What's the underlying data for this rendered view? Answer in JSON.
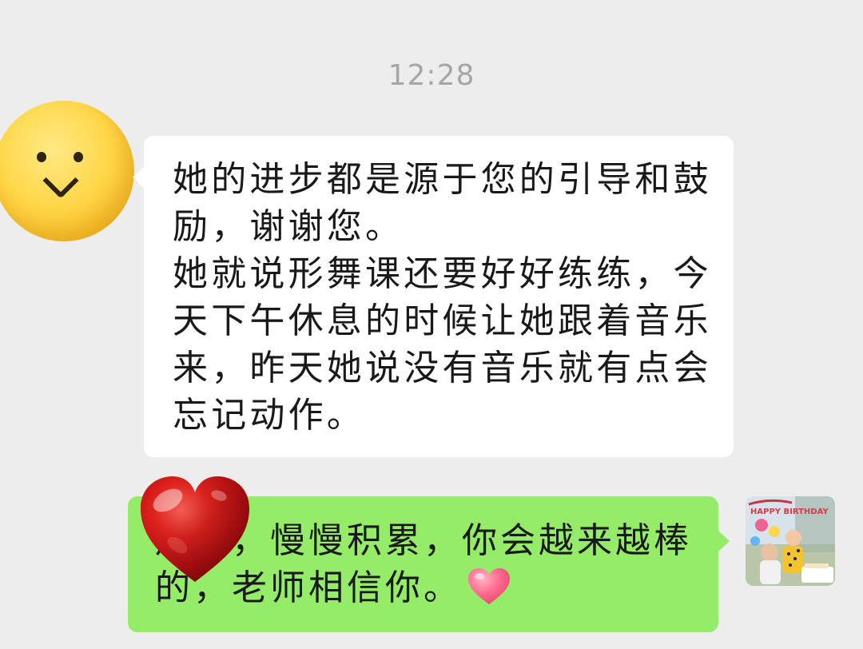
{
  "chat": {
    "timestamp": "12:28",
    "incoming": {
      "avatar_icon": "smiley-face-avatar",
      "text": "她的进步都是源于您的引导和鼓励，谢谢您。\n她就说形舞课还要好好练练，今天下午休息的时候让她跟着音乐来，昨天她说没有音乐就有点会忘记动作。"
    },
    "outgoing": {
      "line1": "加油，慢慢积累，你会越来越棒",
      "line2": "的，老师相信你。",
      "emoji_icon": "pink-heart-emoji",
      "sticker_icon": "red-heart-sticker",
      "avatar_icon": "birthday-photo-avatar",
      "avatar_banner_text": "HAPPY BIRTHDAY"
    }
  },
  "colors": {
    "background": "#ededed",
    "incoming_bubble": "#ffffff",
    "outgoing_bubble": "#95ec69",
    "timestamp_text": "#a6a6a6",
    "message_text": "#191919"
  }
}
